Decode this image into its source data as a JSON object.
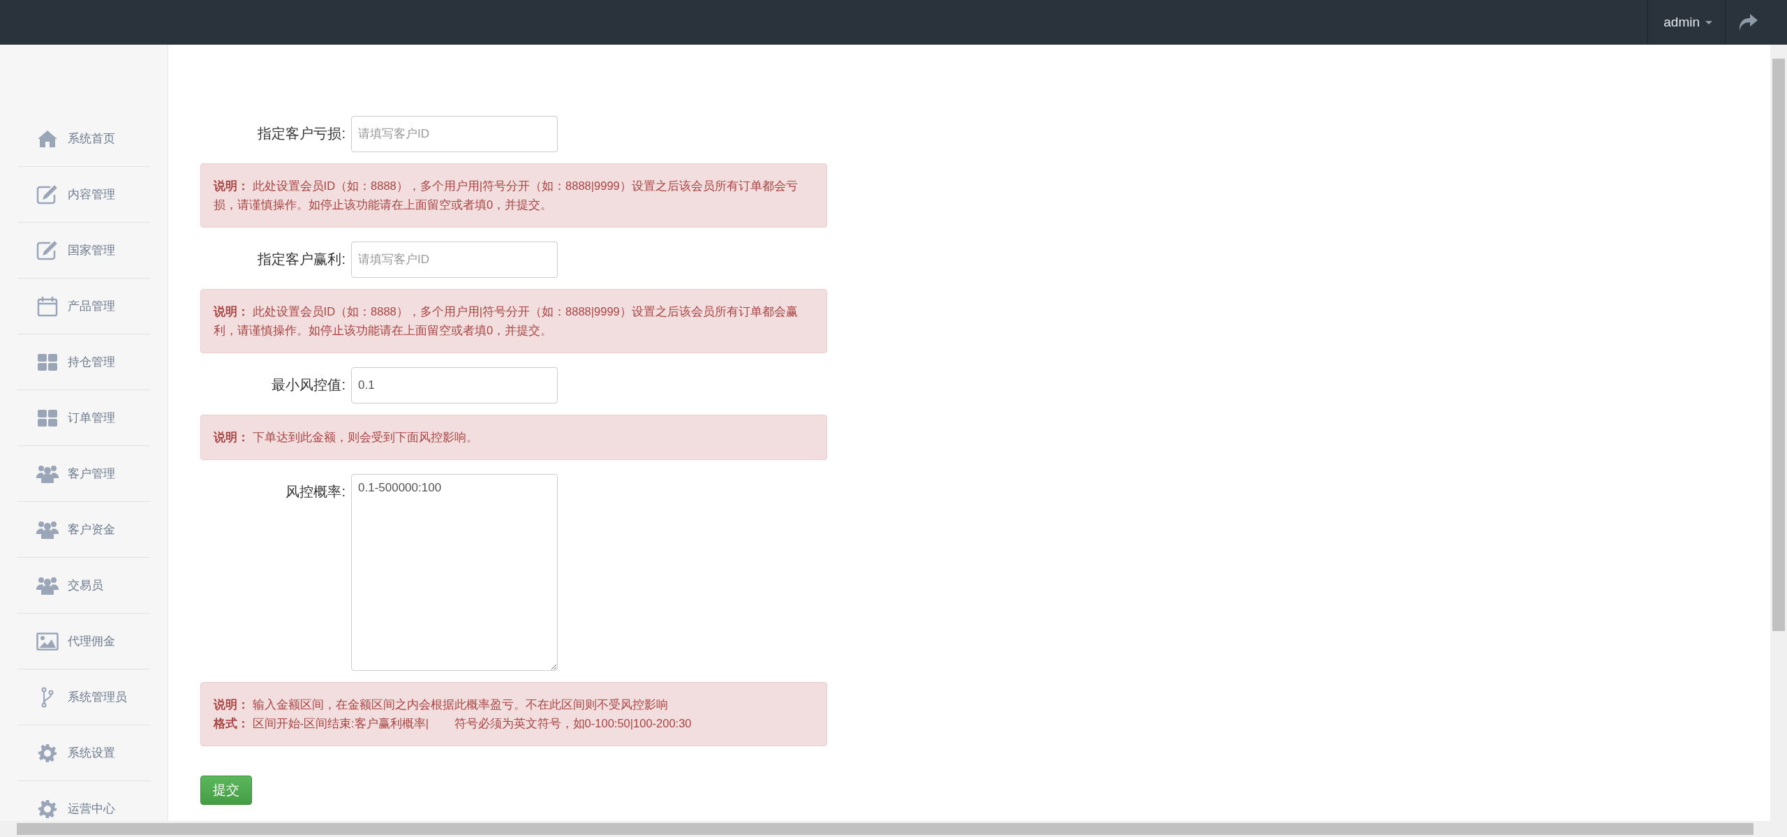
{
  "top_bar": {
    "user": "admin"
  },
  "sidebar": {
    "items": [
      {
        "label": "系统首页"
      },
      {
        "label": "内容管理"
      },
      {
        "label": "国家管理"
      },
      {
        "label": "产品管理"
      },
      {
        "label": "持仓管理"
      },
      {
        "label": "订单管理"
      },
      {
        "label": "客户管理"
      },
      {
        "label": "客户资金"
      },
      {
        "label": "交易员"
      },
      {
        "label": "代理佣金"
      },
      {
        "label": "系统管理员"
      },
      {
        "label": "系统设置"
      },
      {
        "label": "运营中心"
      }
    ]
  },
  "form": {
    "fields": [
      {
        "kind": "input",
        "label": "指定客户亏损:",
        "placeholder": "请填写客户ID",
        "notes": [
          "**说明：** 此处设置会员ID（如：8888），多个用户用|符号分开（如：8888|9999）设置之后该会员所有订单都会亏损，请谨慎操作。如停止该功能请在上面留空或者填0，并提交。"
        ]
      },
      {
        "kind": "input",
        "label": "指定客户赢利:",
        "placeholder": "请填写客户ID",
        "notes": [
          "**说明：** 此处设置会员ID（如：8888），多个用户用|符号分开（如：8888|9999）设置之后该会员所有订单都会赢利，请谨慎操作。如停止该功能请在上面留空或者填0，并提交。"
        ]
      },
      {
        "kind": "input",
        "label": "最小风控值:",
        "value": "0.1",
        "notes": [
          "**说明：** 下单达到此金额，则会受到下面风控影响。"
        ]
      },
      {
        "kind": "textarea",
        "label": "风控概率:",
        "value": "0.1-500000:100",
        "notes": [
          "**说明：** 输入金额区间，在金额区间之内会根据此概率盈亏。不在此区间则不受风控影响",
          "**格式：** 区间开始-区间结束:客户赢利概率|        符号必须为英文符号，如0-100:50|100-200:30"
        ]
      }
    ],
    "submit": "提交"
  }
}
